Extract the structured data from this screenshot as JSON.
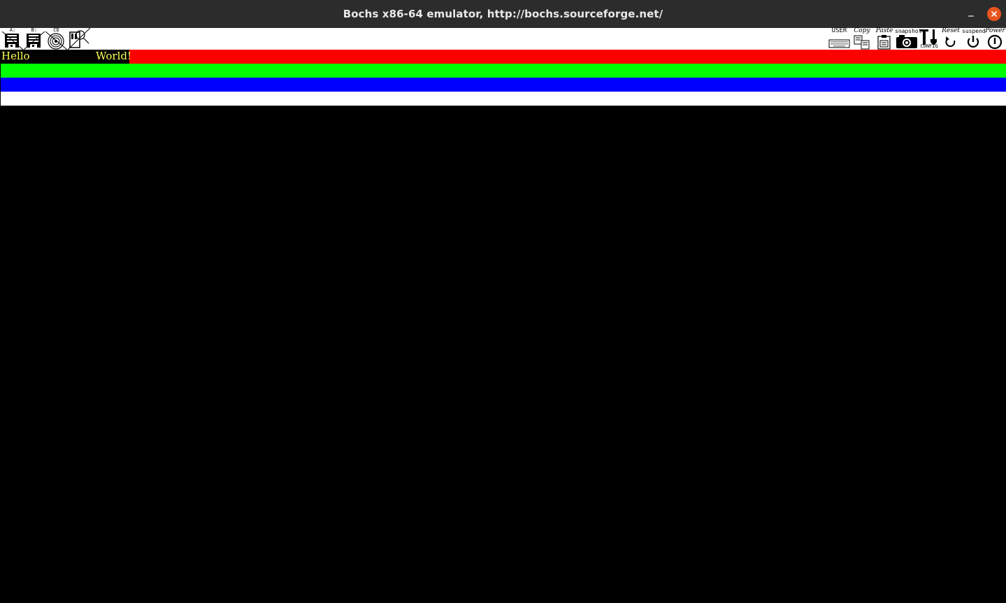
{
  "window": {
    "title": "Bochs x86-64 emulator, http://bochs.sourceforge.net/",
    "minimize_glyph": "–",
    "close_glyph": "✕"
  },
  "toolbar": {
    "floppy_a_label": "A:",
    "floppy_b_label": "B:",
    "cdrom_label": "CD",
    "user_label": "USER",
    "copy_label": "Copy",
    "paste_label": "Paste",
    "snapshot_label": "snapshot",
    "config_label": "CONFIG",
    "reset_label": "Reset",
    "suspend_label": "suspend",
    "power_label": "Power"
  },
  "screen": {
    "text_left": "Hello",
    "text_right": "World!",
    "text_color": "#ffff55",
    "stripes": [
      {
        "name": "red",
        "color": "#ff0000"
      },
      {
        "name": "green",
        "color": "#00ff00"
      },
      {
        "name": "blue",
        "color": "#0000ff"
      },
      {
        "name": "white",
        "color": "#ffffff"
      }
    ],
    "background": "#000000"
  }
}
